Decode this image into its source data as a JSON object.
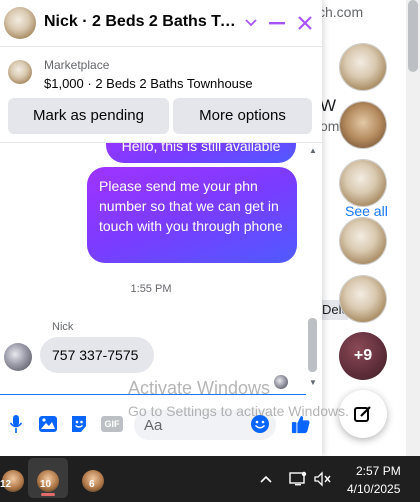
{
  "background": {
    "url_fragment": "ch.com",
    "w_fragment": "W",
    "om_fragment": "om",
    "see_all": "See all",
    "dele_fragment": "Dele",
    "more_count": "+9"
  },
  "chat": {
    "title": "Nick · 2 Beds 2 Baths Towns…",
    "listing": {
      "category": "Marketplace",
      "name": "$1,000 · 2 Beds 2 Baths Townhouse"
    },
    "actions": {
      "mark_pending": "Mark as pending",
      "more_options": "More options"
    },
    "messages": {
      "outgoing_partial": "Hello, this is still available",
      "outgoing_main": "Please send me your phn number so that we can get in touch with you through phone",
      "timestamp": "1:55 PM",
      "sender_name": "Nick",
      "incoming": "757 337-7575"
    },
    "composer": {
      "placeholder": "Aa",
      "gif_label": "GIF"
    },
    "accent_color": "#0866ff",
    "bubble_gradient": [
      "#a033ff",
      "#4f5bff"
    ]
  },
  "watermark": {
    "line1": "Activate Windows",
    "line2": "Go to Settings to activate Windows."
  },
  "taskbar": {
    "apps": [
      {
        "badge": "12"
      },
      {
        "badge": "10"
      },
      {
        "badge": "6"
      }
    ],
    "time": "2:57 PM",
    "date": "4/10/2025"
  }
}
